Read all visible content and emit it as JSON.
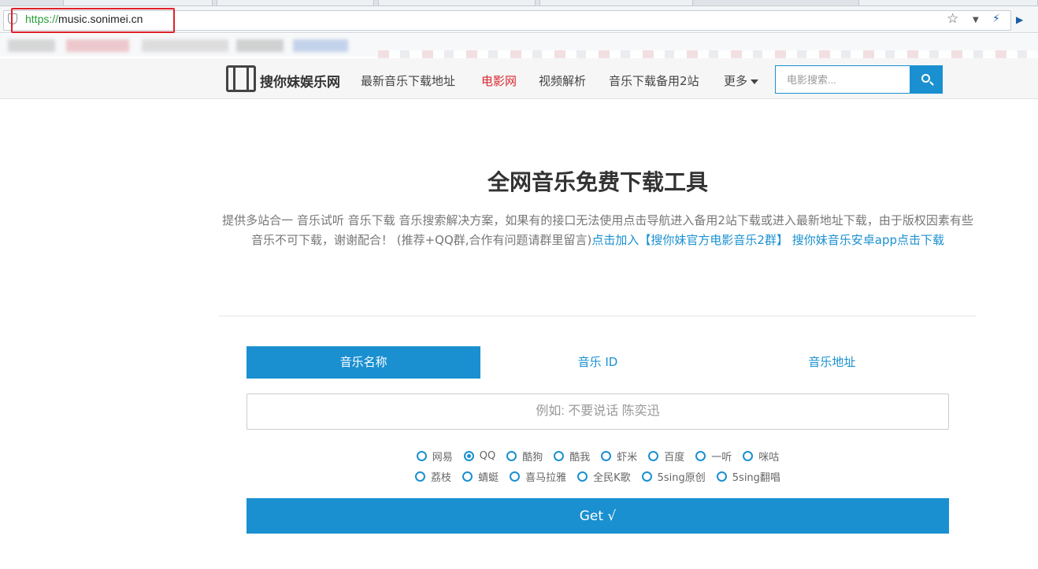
{
  "browser": {
    "url_scheme": "https://",
    "url_host": "music.sonimei.cn"
  },
  "site": {
    "logo": "搜你妹娱乐网",
    "nav": [
      {
        "label": "最新音乐下载地址"
      },
      {
        "label": "电影网"
      },
      {
        "label": "视频解析"
      },
      {
        "label": "音乐下载备用2站"
      },
      {
        "label": "更多"
      }
    ],
    "search_placeholder": "电影搜索..."
  },
  "main": {
    "title": "全网音乐免费下载工具",
    "desc_text": "提供多站合一 音乐试听 音乐下载 音乐搜索解决方案，如果有的接口无法使用点击导航进入备用2站下载或进入最新地址下载，由于版权因素有些音乐不可下载，谢谢配合！ (推荐+QQ群,合作有问题请群里留言)",
    "desc_link1": "点击加入【搜你妹官方电影音乐2群】",
    "desc_link2": "搜你妹音乐安卓app点击下载",
    "tabs": [
      {
        "label": "音乐名称"
      },
      {
        "label": "音乐 ID"
      },
      {
        "label": "音乐地址"
      }
    ],
    "query_placeholder": "例如: 不要说话 陈奕迅",
    "sources_row1": [
      "网易",
      "QQ",
      "酷狗",
      "酷我",
      "虾米",
      "百度",
      "一听",
      "咪咕"
    ],
    "sources_row2": [
      "荔枝",
      "蜻蜓",
      "喜马拉雅",
      "全民K歌",
      "5sing原创",
      "5sing翻唱"
    ],
    "selected_source": "QQ",
    "get_label": "Get √"
  },
  "colors": {
    "accent": "#1a90d0",
    "nav_active": "#d9272e",
    "highlight_box": "#e0212a"
  }
}
